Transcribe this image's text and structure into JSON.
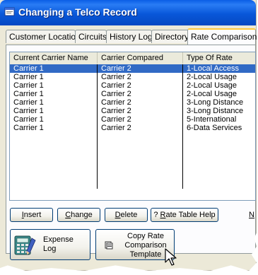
{
  "window": {
    "title": "Changing a Telco Record"
  },
  "tabs": [
    {
      "label": "Customer Location"
    },
    {
      "label": "Circuits"
    },
    {
      "label": "History Log"
    },
    {
      "label": "Directory"
    },
    {
      "label": "Rate Comparison"
    }
  ],
  "list": {
    "columns": [
      "Current Carrier Name",
      "Carrier Compared",
      "Type Of Rate"
    ],
    "rows": [
      {
        "current": "Carrier 1",
        "compared": "Carrier 2",
        "type": "1-Local Access"
      },
      {
        "current": "Carrier 1",
        "compared": "Carrier 2",
        "type": "2-Local Usage"
      },
      {
        "current": "Carrier 1",
        "compared": "Carrier 2",
        "type": "2-Local Usage"
      },
      {
        "current": "Carrier 1",
        "compared": "Carrier 2",
        "type": "2-Local Usage"
      },
      {
        "current": "Carrier 1",
        "compared": "Carrier 2",
        "type": "3-Long Distance"
      },
      {
        "current": "Carrier 1",
        "compared": "Carrier 2",
        "type": "3-Long Distance"
      },
      {
        "current": "Carrier 1",
        "compared": "Carrier 2",
        "type": "5-International"
      },
      {
        "current": "Carrier 1",
        "compared": "Carrier 2",
        "type": "6-Data Services"
      }
    ],
    "selected_row": 0
  },
  "buttons": {
    "insert_first": "I",
    "insert_rest": "nsert",
    "change_first": "C",
    "change_rest": "hange",
    "delete_first": "D",
    "delete_rest": "elete",
    "help_prefix": "? ",
    "help_first": "R",
    "help_rest": "ate Table Help",
    "next_label": "N",
    "expense_line1": "Expense",
    "expense_line2": "Log",
    "copy_line1": "Copy Rate",
    "copy_line2": "Comparison",
    "copy_line3": "Template"
  },
  "colors": {
    "title_bar": "#0857d9",
    "selection": "#316ac5",
    "active_tab_accent": "#ffc83c"
  },
  "icons": {
    "window": "app-window-icon",
    "expense": "calculator-pencil-icon",
    "copy": "copy-template-icon",
    "cursor": "mouse-pointer-icon"
  }
}
